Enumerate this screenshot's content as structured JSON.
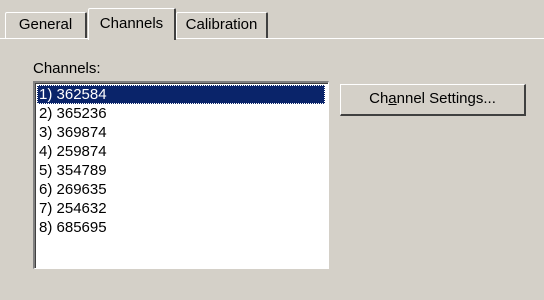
{
  "tabs": [
    {
      "label": "General",
      "active": false
    },
    {
      "label": "Channels",
      "active": true
    },
    {
      "label": "Calibration",
      "active": false
    }
  ],
  "channels_label": "Channels:",
  "channels": [
    "1) 362584",
    "2) 365236",
    "3) 369874",
    "4) 259874",
    "5) 354789",
    "6) 269635",
    "7) 254632",
    "8) 685695"
  ],
  "selected_channel_index": 0,
  "button": {
    "label_before": "Ch",
    "label_mnemonic": "a",
    "label_after": "nnel Settings..."
  }
}
